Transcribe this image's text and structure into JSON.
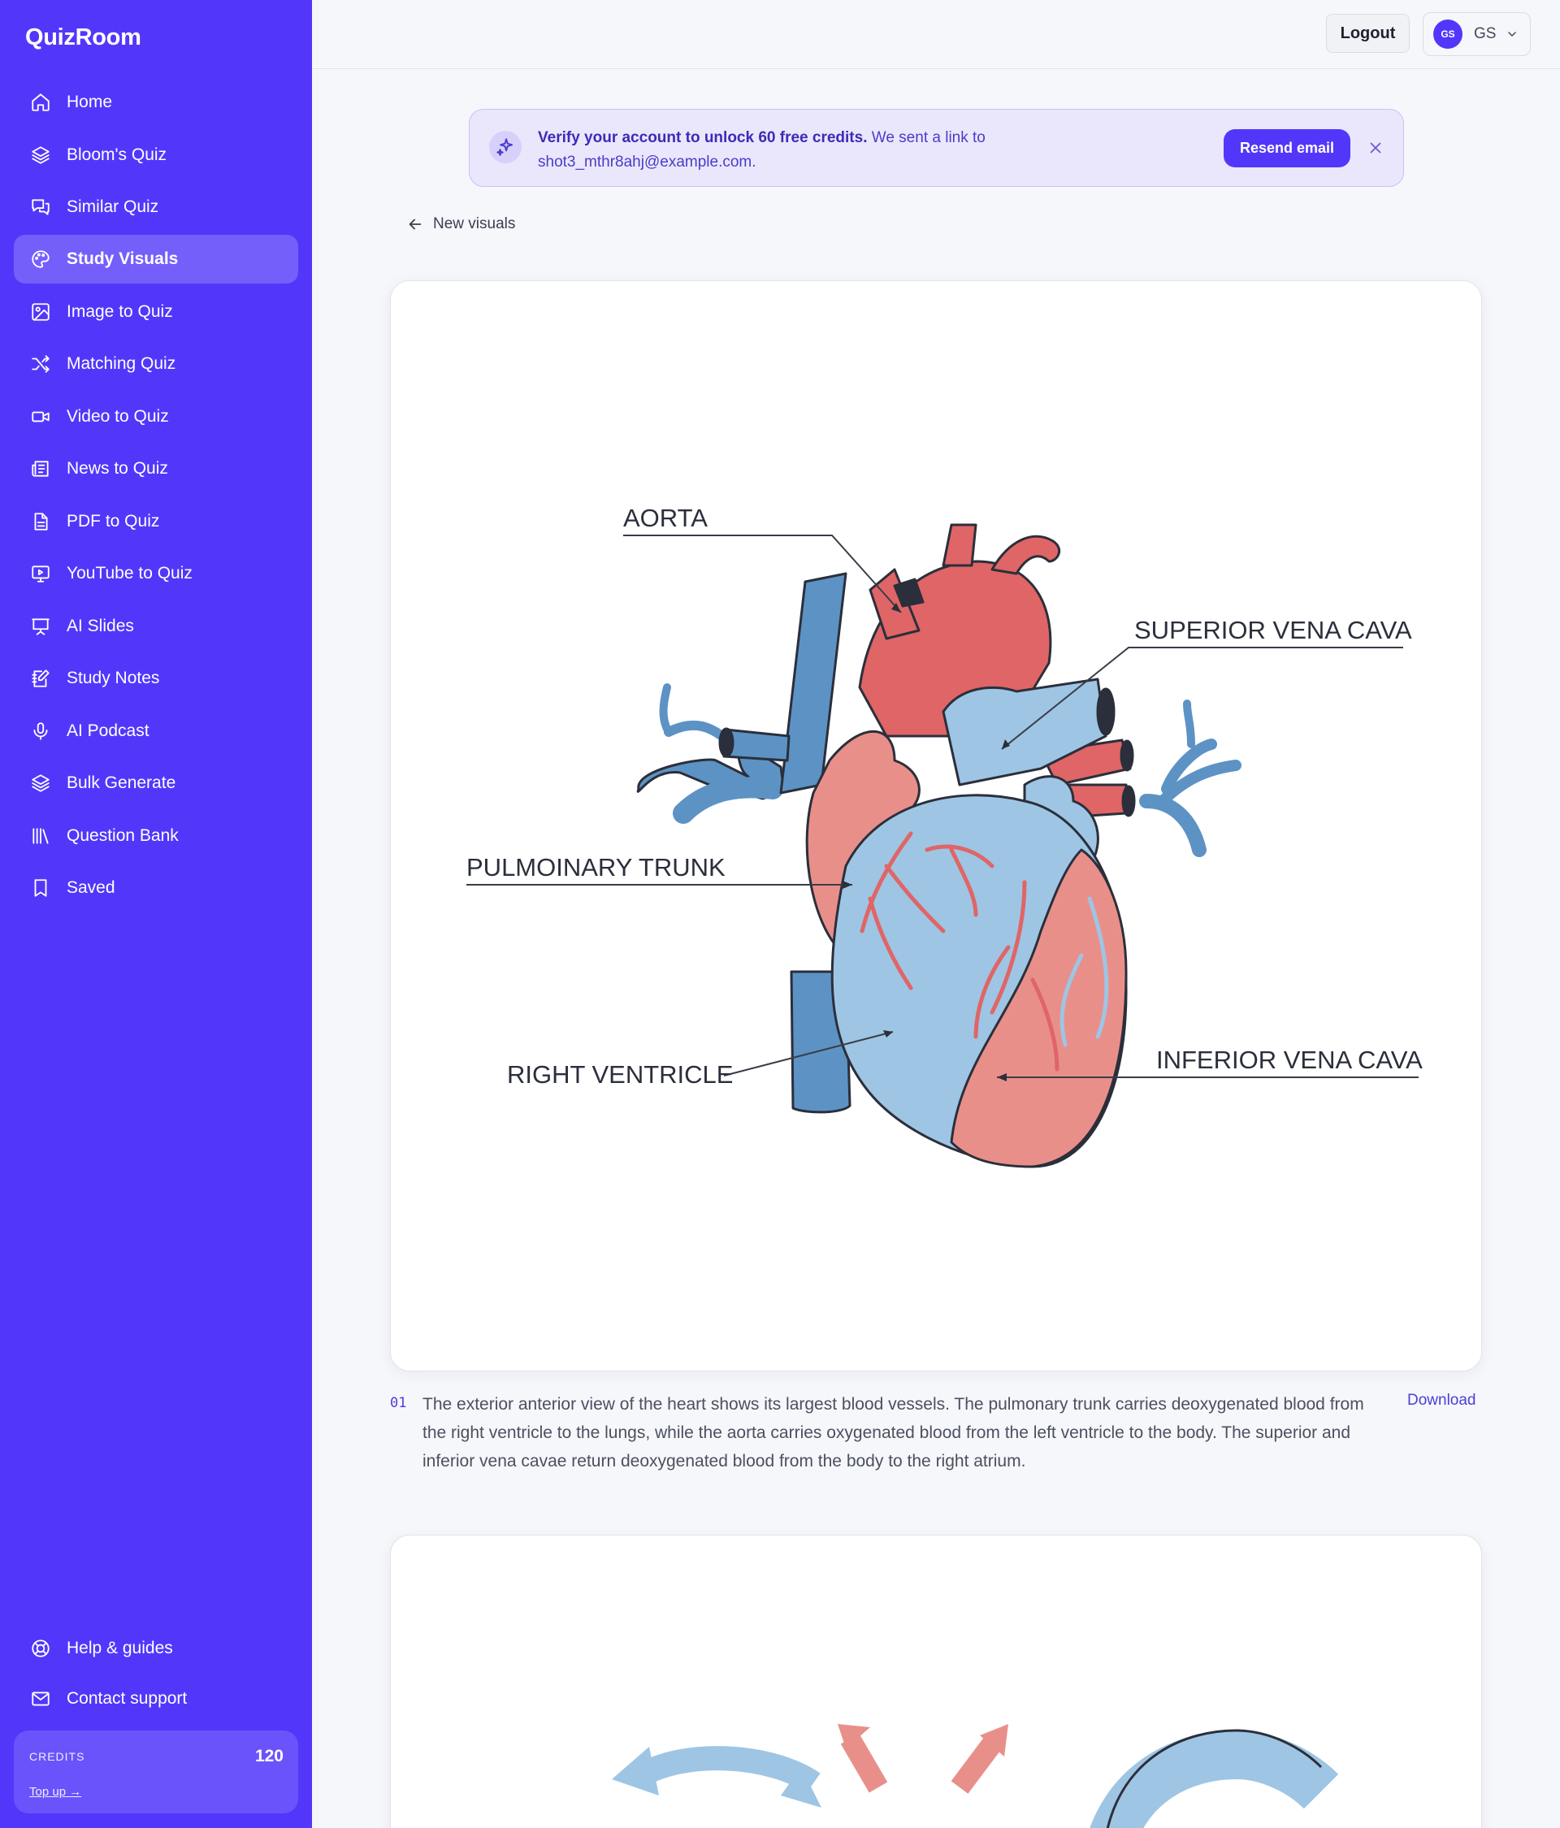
{
  "app": {
    "name": "QuizRoom"
  },
  "sidebar": {
    "items": [
      {
        "label": "Home",
        "icon": "home-icon"
      },
      {
        "label": "Bloom's Quiz",
        "icon": "layers-icon"
      },
      {
        "label": "Similar Quiz",
        "icon": "chat-icon"
      },
      {
        "label": "Study Visuals",
        "icon": "palette-icon",
        "active": true
      },
      {
        "label": "Image to Quiz",
        "icon": "image-icon"
      },
      {
        "label": "Matching Quiz",
        "icon": "shuffle-icon"
      },
      {
        "label": "Video to Quiz",
        "icon": "video-icon"
      },
      {
        "label": "News to Quiz",
        "icon": "newspaper-icon"
      },
      {
        "label": "PDF to Quiz",
        "icon": "document-icon"
      },
      {
        "label": "YouTube to Quiz",
        "icon": "monitor-play-icon"
      },
      {
        "label": "AI Slides",
        "icon": "presentation-icon"
      },
      {
        "label": "Study Notes",
        "icon": "notes-icon"
      },
      {
        "label": "AI Podcast",
        "icon": "microphone-icon"
      },
      {
        "label": "Bulk Generate",
        "icon": "layers-icon"
      },
      {
        "label": "Question Bank",
        "icon": "library-icon"
      },
      {
        "label": "Saved",
        "icon": "bookmark-icon"
      }
    ],
    "footer": [
      {
        "label": "Help & guides",
        "icon": "lifebuoy-icon"
      },
      {
        "label": "Contact support",
        "icon": "mail-icon"
      }
    ],
    "credits": {
      "label": "CREDITS",
      "value": "120",
      "topup": "Top up →"
    }
  },
  "topbar": {
    "logout": "Logout",
    "avatar_initials": "GS",
    "user_initials": "GS"
  },
  "banner": {
    "bold": "Verify your account to unlock 60 free credits.",
    "text": " We sent a link to shot3_mthr8ahj@example.com.",
    "button": "Resend email"
  },
  "back_link": "New visuals",
  "visuals": [
    {
      "number": "01",
      "labels": {
        "aorta": "AORTA",
        "svc": "SUPERIOR VENA CAVA",
        "pulmonary": "PULMOINARY TRUNK",
        "rv": "RIGHT VENTRICLE",
        "ivc": "INFERIOR VENA CAVA"
      },
      "caption": "The exterior anterior view of the heart shows its largest blood vessels. The pulmonary trunk carries deoxygenated blood from the right ventricle to the lungs, while the aorta carries oxygenated blood from the left ventricle to the body. The superior and inferior vena cavae return deoxygenated blood from the body to the right atrium.",
      "download": "Download"
    }
  ],
  "colors": {
    "accent": "#5237fb",
    "vein_blue": "#5c93c4",
    "light_blue": "#9ec5e4",
    "artery_red": "#e06566",
    "pink": "#e98f8a"
  }
}
